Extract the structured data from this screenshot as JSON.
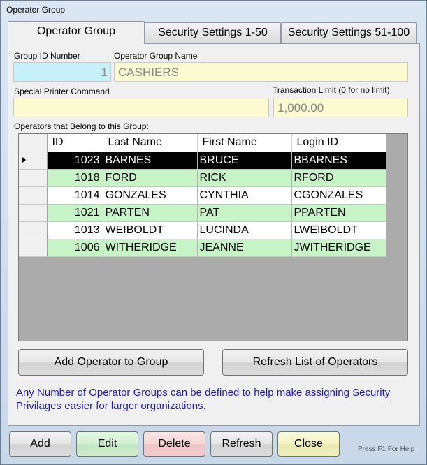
{
  "window": {
    "title": "Operator Group"
  },
  "tabs": [
    {
      "label": "Operator Group",
      "active": true
    },
    {
      "label": "Security Settings 1-50",
      "active": false
    },
    {
      "label": "Security Settings 51-100",
      "active": false
    }
  ],
  "form": {
    "group_id_label": "Group ID Number",
    "group_id_value": "1",
    "group_name_label": "Operator Group Name",
    "group_name_value": "CASHIERS",
    "printer_label": "Special Printer Command",
    "printer_value": "",
    "limit_label": "Transaction Limit (0 for no limit)",
    "limit_value": "1,000.00",
    "operators_label": "Operators that Belong to this Group:"
  },
  "grid": {
    "columns": [
      "ID",
      "Last Name",
      "First Name",
      "Login ID"
    ],
    "rows": [
      {
        "id": "1023",
        "last": "BARNES",
        "first": "BRUCE",
        "login": "BBARNES",
        "selected": true
      },
      {
        "id": "1018",
        "last": "FORD",
        "first": "RICK",
        "login": "RFORD"
      },
      {
        "id": "1014",
        "last": "GONZALES",
        "first": "CYNTHIA",
        "login": "CGONZALES"
      },
      {
        "id": "1021",
        "last": "PARTEN",
        "first": "PAT",
        "login": "PPARTEN"
      },
      {
        "id": "1013",
        "last": "WEIBOLDT",
        "first": "LUCINDA",
        "login": "LWEIBOLDT"
      },
      {
        "id": "1006",
        "last": "WITHERIDGE",
        "first": "JEANNE",
        "login": "JWITHERIDGE"
      }
    ]
  },
  "actions": {
    "add_operator": "Add Operator to Group",
    "refresh_operators": "Refresh List of Operators"
  },
  "note": "Any Number of Operator Groups can be defined to help make assigning Security Privilages easier for larger organizations.",
  "footer": {
    "add": "Add",
    "edit": "Edit",
    "delete": "Delete",
    "refresh": "Refresh",
    "close": "Close",
    "help": "Press F1 For Help"
  },
  "colors": {
    "row_green": "#c6f4c6",
    "id_field": "#c8f0fb",
    "text_field": "#fbfad0",
    "note_text": "#1c1cb0"
  }
}
